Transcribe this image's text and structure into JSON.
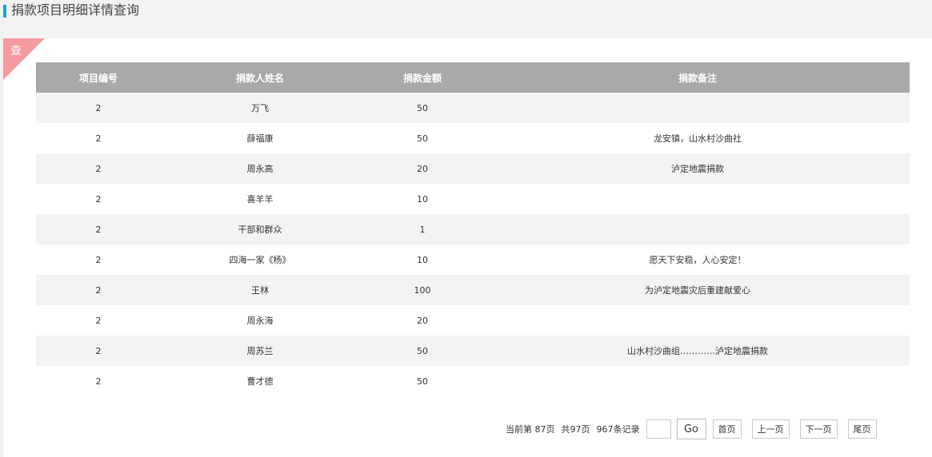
{
  "header": {
    "title": "捐款项目明细详情查询"
  },
  "panel": {
    "corner_label": "查"
  },
  "table": {
    "columns": [
      "项目编号",
      "捐款人姓名",
      "捐款金额",
      "捐款备注"
    ],
    "rows": [
      [
        "2",
        "万飞",
        "50",
        ""
      ],
      [
        "2",
        "薛福康",
        "50",
        "龙安镇，山水村沙曲社"
      ],
      [
        "2",
        "周永高",
        "20",
        "泸定地震捐款"
      ],
      [
        "2",
        "喜羊羊",
        "10",
        ""
      ],
      [
        "2",
        "干部和群众",
        "1",
        ""
      ],
      [
        "2",
        "四海一家《杨》",
        "10",
        "愿天下安稳，人心安定！"
      ],
      [
        "2",
        "王林",
        "100",
        "为泸定地震灾后重建献爱心"
      ],
      [
        "2",
        "周永海",
        "20",
        ""
      ],
      [
        "2",
        "周苏兰",
        "50",
        "山水村沙曲组…………泸定地震捐款"
      ],
      [
        "2",
        "曹才德",
        "50",
        ""
      ]
    ]
  },
  "pager": {
    "current": "当前第  87页",
    "total_pages": "共97页",
    "total_records": "967条记录",
    "go_label": "Go",
    "first_label": "首页",
    "prev_label": "上一页",
    "next_label": "下一页",
    "last_label": "尾页"
  },
  "colors": {
    "accent": "#1aa1d6",
    "corner": "#f39b9f",
    "header_bg": "#a9a9a9"
  }
}
